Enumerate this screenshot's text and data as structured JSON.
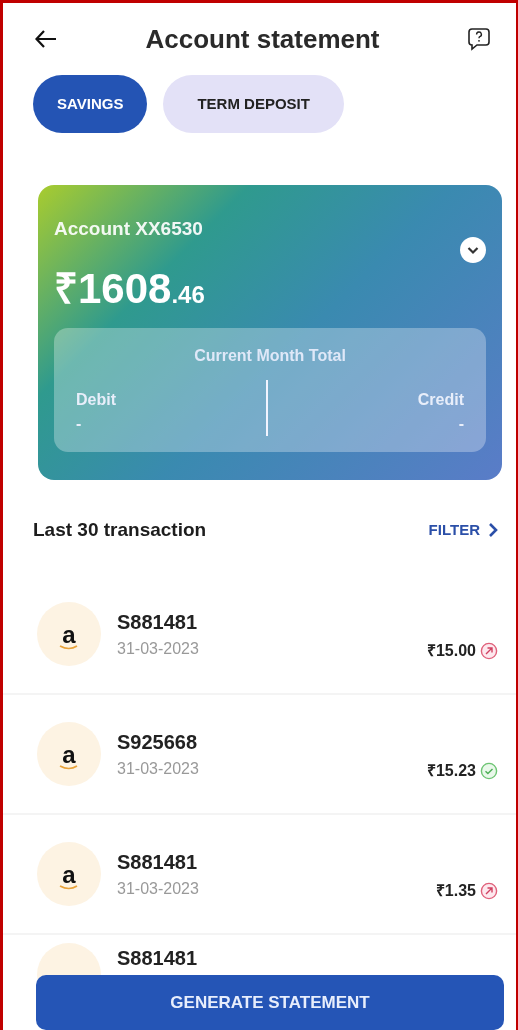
{
  "header": {
    "title": "Account statement"
  },
  "tabs": [
    {
      "label": "SAVINGS",
      "selected": true
    },
    {
      "label": "TERM DEPOSIT",
      "selected": false
    }
  ],
  "account_card": {
    "account": "Account XX6530",
    "balance_whole": "₹1608",
    "balance_fraction": ".46",
    "summary": {
      "title": "Current Month Total",
      "debit_label": "Debit",
      "debit_value": "-",
      "credit_label": "Credit",
      "credit_value": "-"
    }
  },
  "transactions_header": {
    "title": "Last 30 transaction",
    "filter": "FILTER"
  },
  "transactions": [
    {
      "avatar": "a",
      "name": "S881481",
      "date": "31-03-2023",
      "amount": "₹15.00",
      "kind": "debit"
    },
    {
      "avatar": "a",
      "name": "S925668",
      "date": "31-03-2023",
      "amount": "₹15.23",
      "kind": "credit"
    },
    {
      "avatar": "a",
      "name": "S881481",
      "date": "31-03-2023",
      "amount": "₹1.35",
      "kind": "debit"
    },
    {
      "name": "S881481",
      "kind": "partial"
    }
  ],
  "button": "GENERATE STATEMENT"
}
